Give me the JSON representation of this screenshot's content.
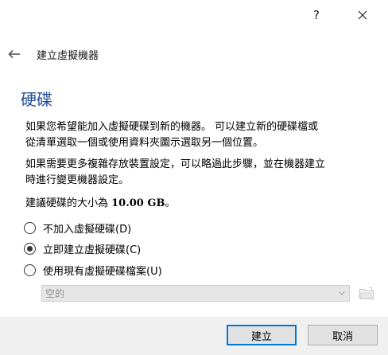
{
  "titlebar": {
    "help_label": "?",
    "close_icon": "close-icon"
  },
  "nav": {
    "back_icon": "back-arrow-icon",
    "title": "建立虛擬機器"
  },
  "page": {
    "title": "硬碟",
    "paragraph_1": "如果您希望能加入虛擬硬碟到新的機器。 可以建立新的硬碟檔或\n從清單選取一個或使用資料夾圖示選取另一個位置。",
    "paragraph_2": "如果需要更多複雜存放裝置設定，可以略過此步驟，並在機器建立\n時進行變更機器設定。",
    "recommend_prefix": "建議硬碟的大小為 ",
    "recommend_size": "10.00 GB",
    "recommend_suffix": "。"
  },
  "options": [
    {
      "label": "不加入虛擬硬碟(D)",
      "checked": false
    },
    {
      "label": "立即建立虛擬硬碟(C)",
      "checked": true
    },
    {
      "label": "使用現有虛擬硬碟檔案(U)",
      "checked": false
    }
  ],
  "file_select": {
    "value": "空的",
    "enabled": false,
    "dropdown_icon": "chevron-down-icon",
    "browse_icon": "folder-icon"
  },
  "buttons": {
    "create": "建立",
    "cancel": "取消"
  },
  "colors": {
    "title_blue": "#1f4e99",
    "default_button_border": "#0078d7",
    "footer_bg": "#f0f0f0"
  }
}
